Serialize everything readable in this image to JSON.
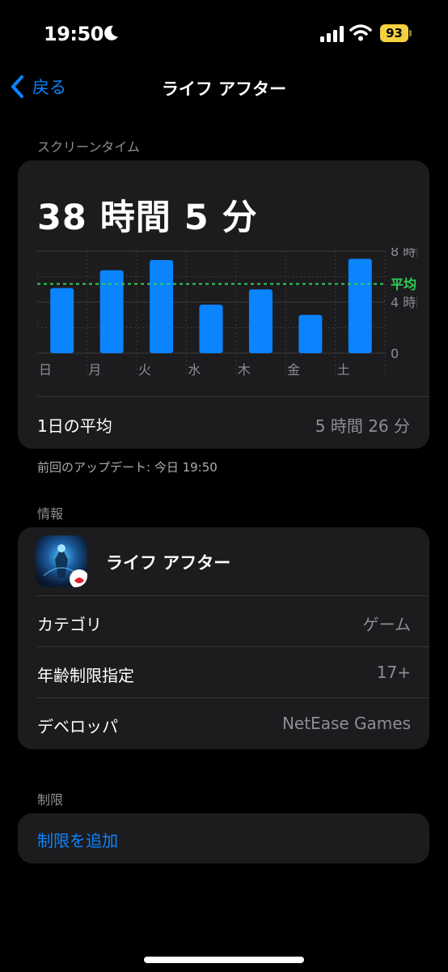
{
  "status_bar": {
    "time": "19:50",
    "battery_level": "93",
    "battery_color": "#f4d03f"
  },
  "nav": {
    "back_label": "戻る",
    "title": "ライフ アフター",
    "accent_color": "#0a84ff"
  },
  "screen_time": {
    "section_label": "スクリーンタイム",
    "total": "38 時間 5 分",
    "average_label": "1日の平均",
    "average_value": "5 時間 26 分",
    "updated": "前回のアップデート: 今日 19:50"
  },
  "chart_data": {
    "type": "bar",
    "categories": [
      "日",
      "月",
      "火",
      "水",
      "木",
      "金",
      "土"
    ],
    "values": [
      5.1,
      6.5,
      7.3,
      3.8,
      5.0,
      3.0,
      7.4
    ],
    "ylim": [
      0,
      8
    ],
    "ytick_labels": [
      "8 時間",
      "4 時間",
      "0"
    ],
    "ytick_values": [
      8,
      4,
      0
    ],
    "average": 5.43,
    "average_label": "平均",
    "bar_color": "#0a84ff",
    "average_color": "#30d158",
    "grid": true
  },
  "info": {
    "section_label": "情報",
    "app_name": "ライフ アフター",
    "rows": [
      {
        "label": "カテゴリ",
        "value": "ゲーム"
      },
      {
        "label": "年齢制限指定",
        "value": "17+"
      },
      {
        "label": "デベロッパ",
        "value": "NetEase Games"
      }
    ]
  },
  "limits": {
    "section_label": "制限",
    "add_label": "制限を追加"
  }
}
